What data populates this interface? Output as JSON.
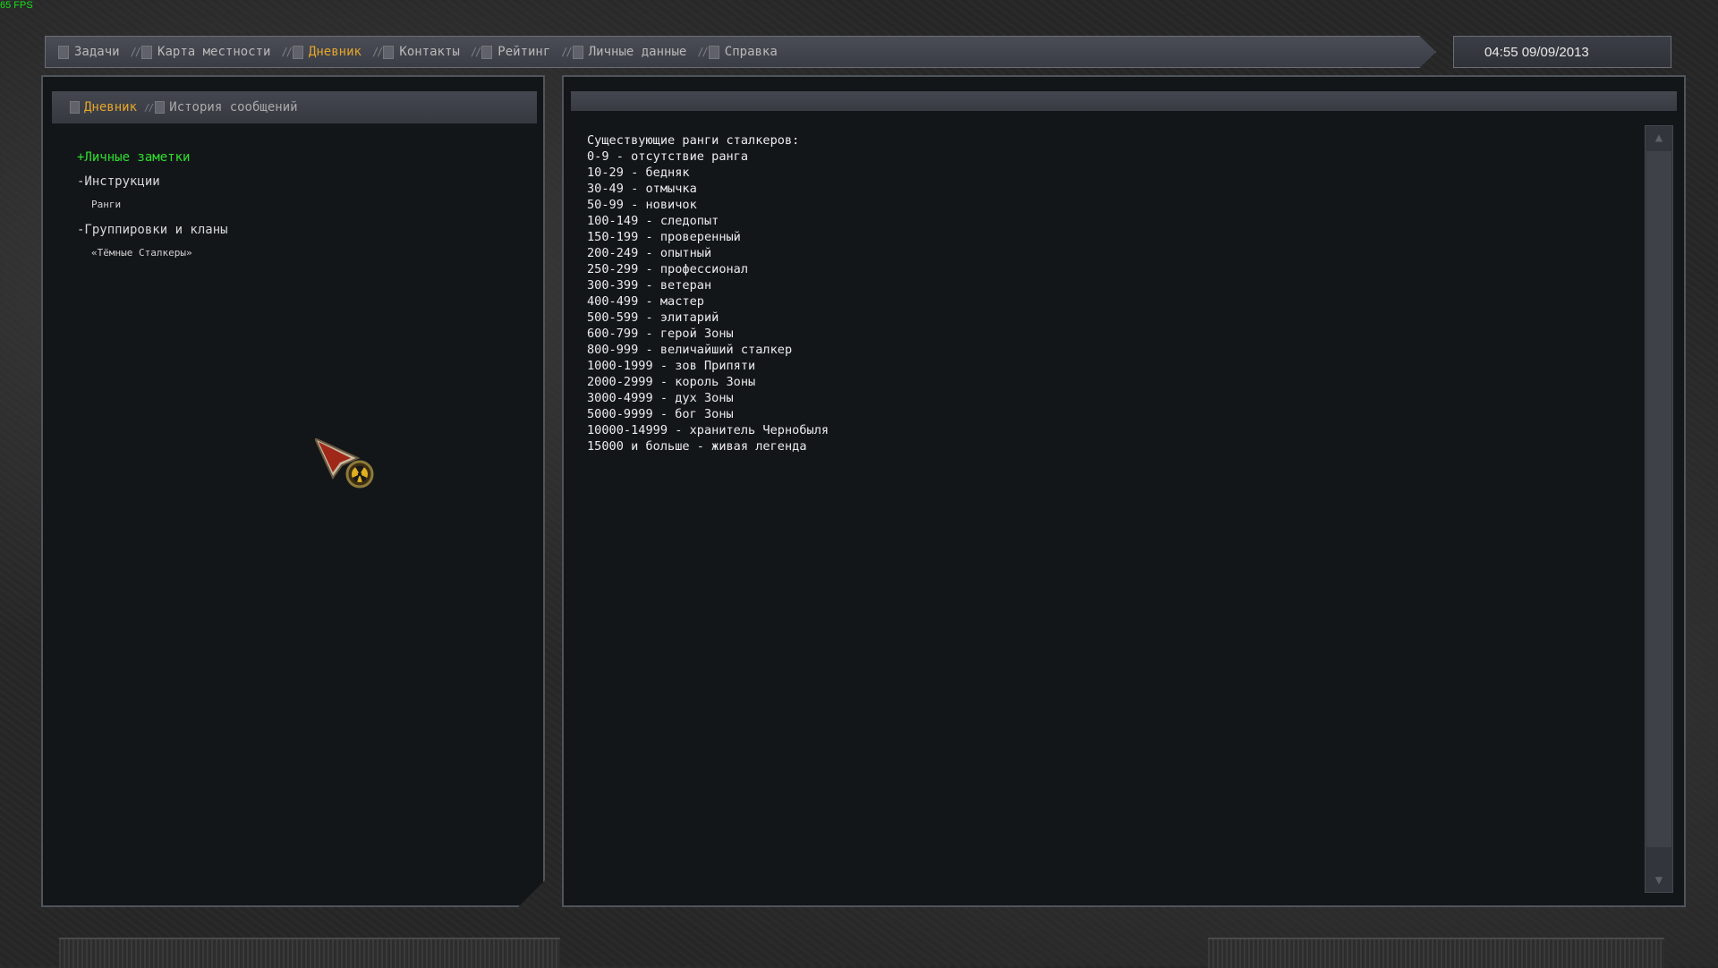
{
  "hud": {
    "fps": "65 FPS"
  },
  "topbar": {
    "tabs": [
      {
        "label": "Задачи"
      },
      {
        "label": "Карта местности"
      },
      {
        "label": "Дневник"
      },
      {
        "label": "Контакты"
      },
      {
        "label": "Рейтинг"
      },
      {
        "label": "Личные данные"
      },
      {
        "label": "Справка"
      }
    ],
    "active_tab": "Дневник",
    "clock": "04:55 09/09/2013"
  },
  "left_panel": {
    "subtabs": [
      {
        "label": "Дневник"
      },
      {
        "label": "История сообщений"
      }
    ],
    "tree": {
      "personal_notes": "+Личные заметки",
      "instructions": "-Инструкции",
      "ranks": "Ранги",
      "factions": "-Группировки и кланы",
      "dark_stalkers": "«Тёмные Сталкеры»"
    }
  },
  "right_panel": {
    "lines": [
      "Существующие ранги сталкеров:",
      "0-9 - отсутствие ранга",
      "10-29 - бедняк",
      "30-49 - отмычка",
      "50-99 - новичок",
      "100-149 - следопыт",
      "150-199 - проверенный",
      "200-249 - опытный",
      "250-299 - профессионал",
      "300-399 - ветеран",
      "400-499 - мастер",
      "500-599 - элитарий",
      "600-799 - герой Зоны",
      "800-999 - величайший сталкер",
      "1000-1999 - зов Припяти",
      "2000-2999 - король Зоны",
      "3000-4999 - дух Зоны",
      "5000-9999 - бог Зоны",
      "10000-14999 - хранитель Чернобыля",
      "15000 и больше - живая легенда"
    ]
  },
  "colors": {
    "active_tab": "#e5a52c",
    "selected_node": "#2ee02e",
    "fps": "#18e018"
  }
}
